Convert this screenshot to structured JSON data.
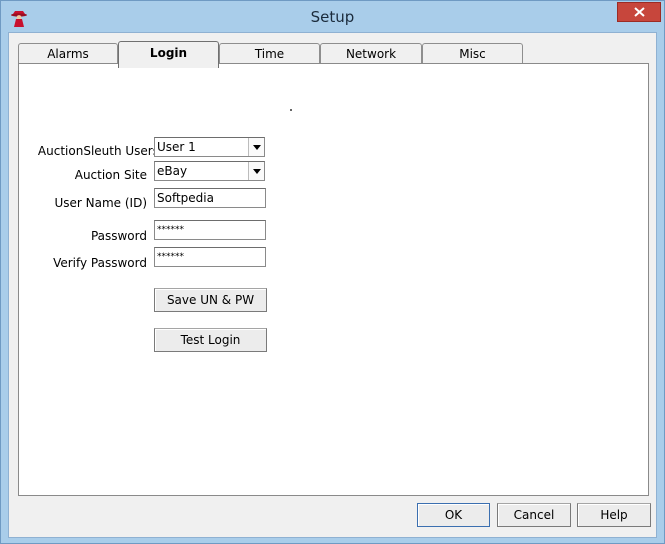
{
  "window": {
    "title": "Setup"
  },
  "tabs": [
    {
      "label": "Alarms"
    },
    {
      "label": "Login",
      "active": true
    },
    {
      "label": "Time"
    },
    {
      "label": "Network"
    },
    {
      "label": "Misc"
    }
  ],
  "login": {
    "users": {
      "label": "AuctionSleuth Users",
      "value": "User 1"
    },
    "site": {
      "label": "Auction Site",
      "value": "eBay"
    },
    "username": {
      "label": "User Name (ID)",
      "value": "Softpedia"
    },
    "password": {
      "label": "Password",
      "value": "******"
    },
    "verify": {
      "label": "Verify Password",
      "value": "******"
    },
    "save_button": "Save UN & PW",
    "test_button": "Test Login"
  },
  "footer": {
    "ok": "OK",
    "cancel": "Cancel",
    "help": "Help"
  },
  "colors": {
    "titlebar": "#a9cdea",
    "close": "#c7463c",
    "dialog": "#f0f0f0",
    "panel": "#ffffff"
  }
}
